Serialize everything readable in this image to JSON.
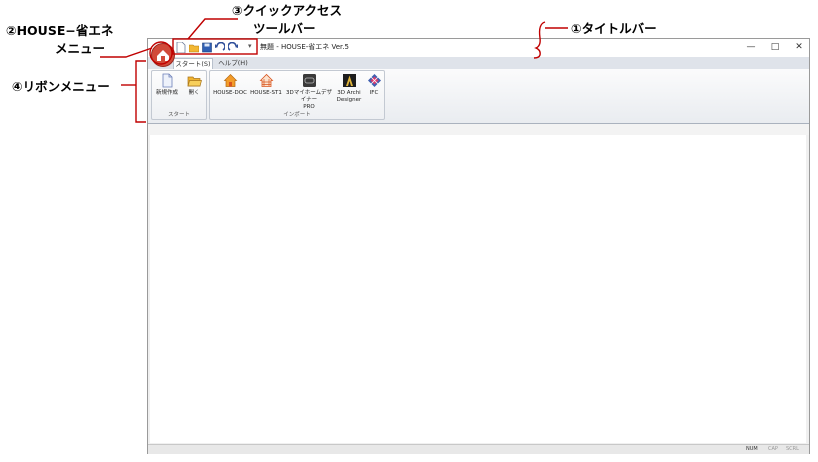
{
  "callouts": {
    "title_bar": "①タイトルバー",
    "house_menu_line1": "②HOUSE−省エネ",
    "house_menu_line2": "メニュー",
    "qat_line1": "③クイックアクセス",
    "qat_line2": "ツールバー",
    "ribbon_menu": "④リボンメニュー"
  },
  "window": {
    "title": "無題 - HOUSE-省エネ Ver.5",
    "minimize": "—",
    "maximize": "□",
    "close": "✕"
  },
  "qat": {
    "icons": [
      "new-file-icon",
      "open-folder-icon",
      "save-icon",
      "undo-icon",
      "redo-icon"
    ],
    "dropdown": "▾"
  },
  "tabs": {
    "start": "スタート(S)",
    "help": "ヘルプ(H)"
  },
  "ribbon": {
    "start_group": {
      "label": "スタート",
      "new": "新規作成",
      "open": "開く"
    },
    "import_group": {
      "label": "インポート",
      "house_doc": "HOUSE-DOC",
      "house_st1": "HOUSE-ST1",
      "my_home_line1": "3Dマイホームデザイナー",
      "my_home_line2": "PRO",
      "archi_line1": "3D Archi",
      "archi_line2": "Designer",
      "ifc": "IFC"
    }
  },
  "status": {
    "num": "NUM",
    "cap": "CAP",
    "scrl": "SCRL"
  },
  "colors": {
    "callout_line": "#c00000",
    "house_button": "#d14a3a"
  }
}
